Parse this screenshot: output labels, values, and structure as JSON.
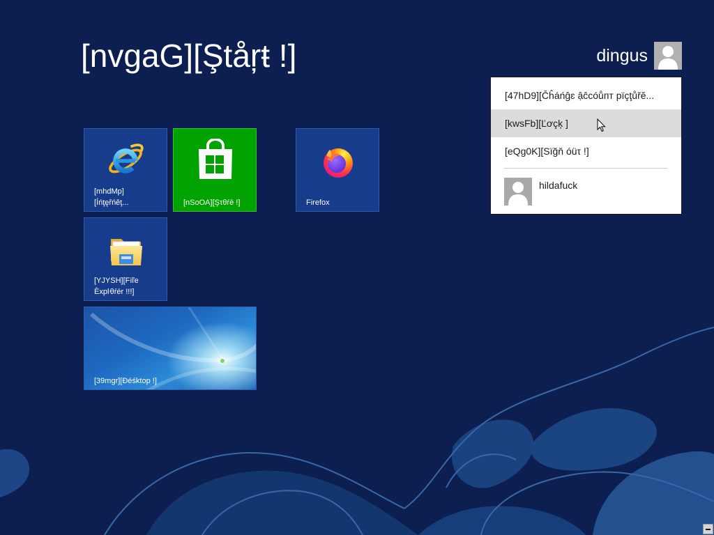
{
  "colors": {
    "background": "#0c1f50",
    "tile_blue": "#173c8c",
    "tile_green": "#00a300",
    "menu_highlight": "#dcdcdc",
    "text_light": "#ffffff"
  },
  "start_screen": {
    "title": "[nvgaG][Ştåŗŧ !]"
  },
  "user": {
    "name": "dingus",
    "avatar_icon": "user-avatar-icon"
  },
  "account_menu": {
    "items": [
      {
        "label": "[47hD9][Čĥáńĝɛ ậĉcóůпт pïçţůřĕ...",
        "highlighted": false
      },
      {
        "label": "[kwsFb][Ľơçķ ]",
        "highlighted": true
      },
      {
        "label": "[eQg0K][Sïğň óüτ !]",
        "highlighted": false
      }
    ],
    "other_users": [
      {
        "name": "hildafuck",
        "avatar_icon": "user-avatar-icon"
      }
    ]
  },
  "tiles": [
    {
      "icon": "internet-explorer-icon",
      "label_lines": [
        "[mhdMp]",
        "[Íńţęřńěţ..."
      ]
    },
    {
      "icon": "store-icon",
      "label_lines": [
        "[nSoOA][Şτθŕē !]"
      ]
    },
    {
      "icon": "firefox-icon",
      "label_lines": [
        "Firefox"
      ]
    },
    {
      "icon": "file-explorer-icon",
      "label_lines": [
        "[YJYSH][Fíľe",
        "Èxpŀθŕér !!!]"
      ]
    },
    {
      "icon": "desktop-wallpaper-thumbnail",
      "label_lines": [
        "[39mgr][Ðéśktop !]"
      ]
    }
  ],
  "cursor": {
    "icon": "mouse-pointer-icon"
  },
  "zoom_button": {
    "icon": "minus-icon"
  }
}
